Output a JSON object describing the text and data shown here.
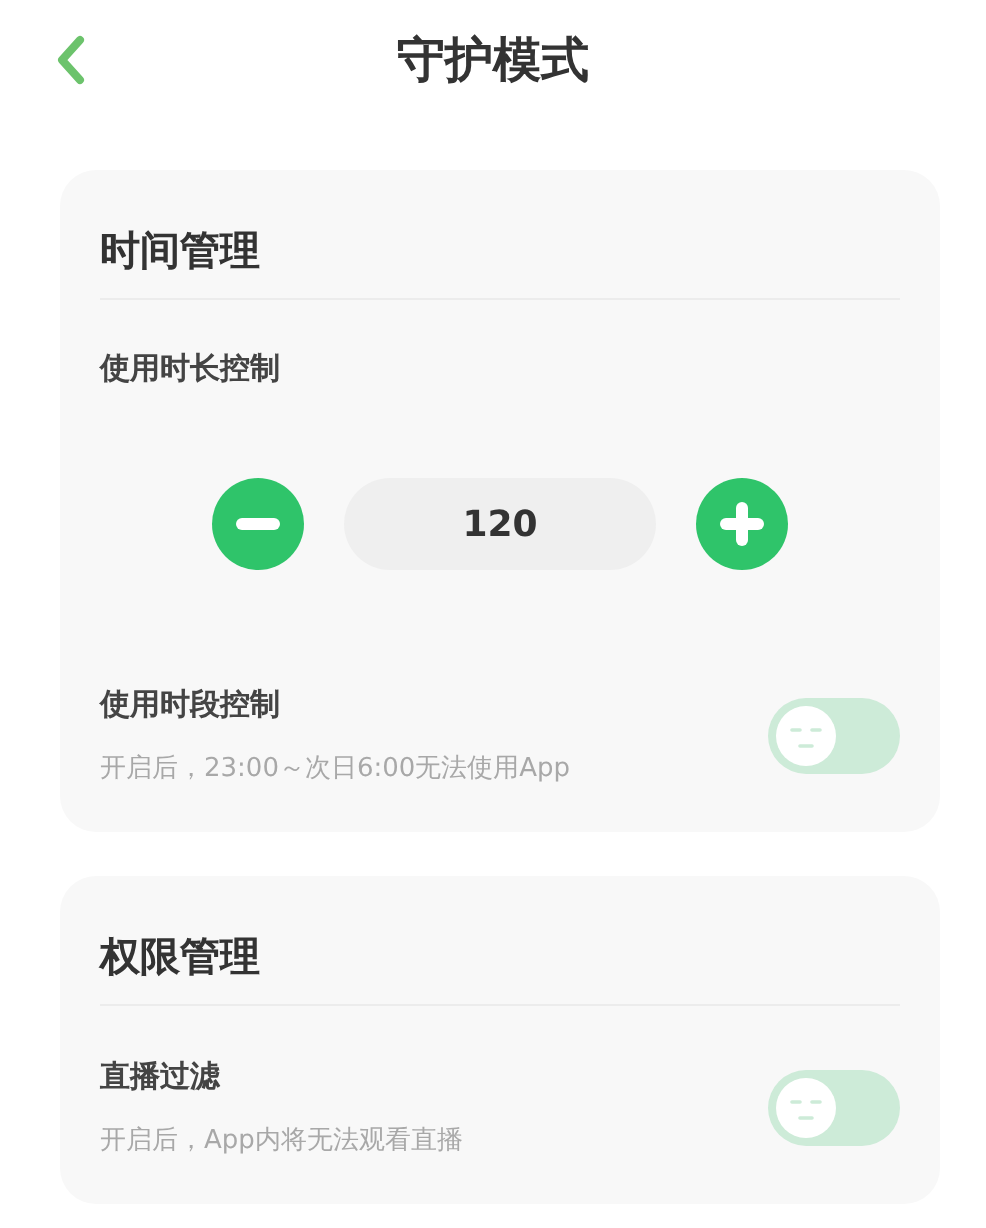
{
  "header": {
    "title": "守护模式"
  },
  "sections": [
    {
      "title": "时间管理",
      "items": [
        {
          "kind": "stepper",
          "label": "使用时长控制",
          "value": "120"
        },
        {
          "kind": "toggle",
          "label": "使用时段控制",
          "description": "开启后，23:00～次日6:00无法使用App",
          "on": false
        }
      ]
    },
    {
      "title": "权限管理",
      "items": [
        {
          "kind": "toggle",
          "label": "直播过滤",
          "description": "开启后，App内将无法观看直播",
          "on": false
        }
      ]
    }
  ]
}
